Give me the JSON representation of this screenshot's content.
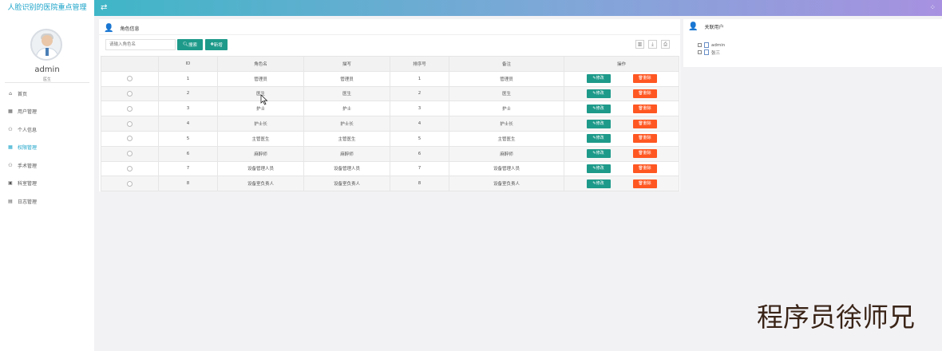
{
  "app": {
    "title": "人脸识别的医院重点管理"
  },
  "header": {
    "toggle_icon": "swap-icon",
    "grid_icon": "grid-icon"
  },
  "user": {
    "name": "admin",
    "role": "医生"
  },
  "sidebar": {
    "items": [
      {
        "label": "首页",
        "icon": "home-icon",
        "active": false
      },
      {
        "label": "用户管理",
        "icon": "calendar-icon",
        "active": false
      },
      {
        "label": "个人信息",
        "icon": "user-group-icon",
        "active": false
      },
      {
        "label": "权限管理",
        "icon": "calendar-icon",
        "active": true
      },
      {
        "label": "手术管理",
        "icon": "user-group-icon",
        "active": false
      },
      {
        "label": "科室管理",
        "icon": "book-icon",
        "active": false
      },
      {
        "label": "日志管理",
        "icon": "list-icon",
        "active": false
      }
    ]
  },
  "main": {
    "title": "角色信息",
    "search": {
      "placeholder": "请输入角色名",
      "value": ""
    },
    "search_button": "搜索",
    "add_button": "新增",
    "table": {
      "columns": [
        "",
        "ID",
        "角色名",
        "描写",
        "排序号",
        "备注",
        "操作"
      ],
      "rows": [
        {
          "id": "1",
          "name": "管理员",
          "desc": "管理员",
          "sort": "1",
          "note": "管理员"
        },
        {
          "id": "2",
          "name": "医生",
          "desc": "医生",
          "sort": "2",
          "note": "医生"
        },
        {
          "id": "3",
          "name": "护士",
          "desc": "护士",
          "sort": "3",
          "note": "护士"
        },
        {
          "id": "4",
          "name": "护士长",
          "desc": "护士长",
          "sort": "4",
          "note": "护士长"
        },
        {
          "id": "5",
          "name": "主管医生",
          "desc": "主管医生",
          "sort": "5",
          "note": "主管医生"
        },
        {
          "id": "6",
          "name": "麻醉师",
          "desc": "麻醉师",
          "sort": "6",
          "note": "麻醉师"
        },
        {
          "id": "7",
          "name": "设备管理人员",
          "desc": "设备管理人员",
          "sort": "7",
          "note": "设备管理人员"
        },
        {
          "id": "8",
          "name": "设备室负责人",
          "desc": "设备室负责人",
          "sort": "8",
          "note": "设备室负责人"
        }
      ],
      "edit_label": "修改",
      "delete_label": "删除"
    }
  },
  "right": {
    "title": "关联用户",
    "users": [
      "admin",
      "张三"
    ]
  },
  "watermark": "程序员徐师兄",
  "colors": {
    "accent": "#1aa3c9",
    "primary_button": "#1e9a8a",
    "danger_button": "#ff5722"
  }
}
